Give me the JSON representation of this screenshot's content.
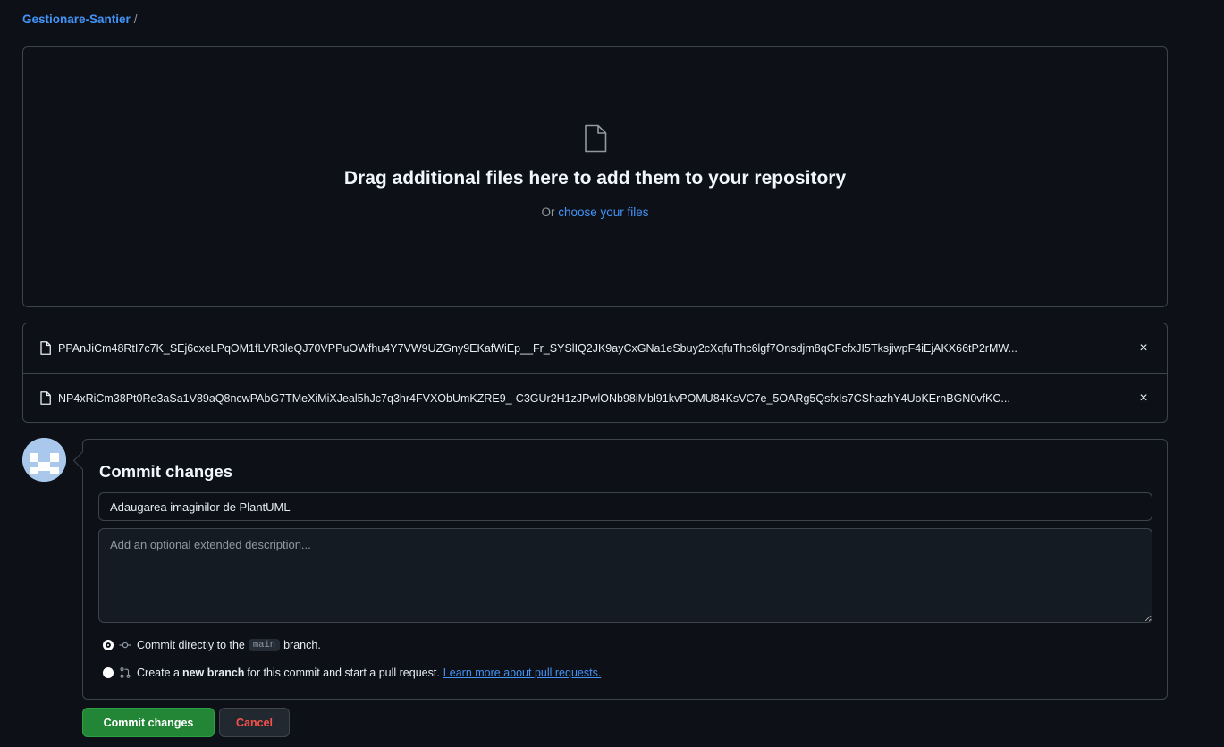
{
  "breadcrumb": {
    "repo": "Gestionare-Santier",
    "separator": "/"
  },
  "dropzone": {
    "icon": "file-icon",
    "headline": "Drag additional files here to add them to your repository",
    "sub_prefix": "Or",
    "sub_link": "choose your files"
  },
  "files": [
    {
      "icon": "file-icon",
      "name": "PPAnJiCm48RtI7c7K_SEj6cxeLPqOM1fLVR3leQJ70VPPuOWfhu4Y7VW9UZGny9EKafWiEp__Fr_SYSlIQ2JK9ayCxGNa1eSbuy2cXqfuThc6lgf7Onsdjm8qCFcfxJI5TksjiwpF4iEjAKX66tP2rMW..."
    },
    {
      "icon": "file-icon",
      "name": "NP4xRiCm38Pt0Re3aSa1V89aQ8ncwPAbG7TMeXiMiXJeal5hJc7q3hr4FVXObUmKZRE9_-C3GUr2H1zJPwlONb98iMbl91kvPOMU84KsVC7e_5OARg5QsfxIs7CShazhY4UoKErnBGN0vfKC..."
    }
  ],
  "remove_label": "×",
  "commit": {
    "title": "Commit changes",
    "summary_value": "Adaugarea imaginilor de PlantUML",
    "description_placeholder": "Add an optional extended description...",
    "option1": {
      "prefix": "Commit directly to the",
      "branch": "main",
      "suffix": "branch.",
      "icon": "git-commit-icon",
      "checked": true
    },
    "option2": {
      "prefix": "Create a",
      "bold": "new branch",
      "suffix": "for this commit and start a pull request.",
      "link": "Learn more about pull requests.",
      "icon": "git-pull-request-icon",
      "checked": false
    }
  },
  "buttons": {
    "commit": "Commit changes",
    "cancel": "Cancel"
  },
  "colors": {
    "background": "#0d1117",
    "border": "#3d444d",
    "link": "#4493f8",
    "primary": "#238636",
    "danger": "#f85149"
  }
}
